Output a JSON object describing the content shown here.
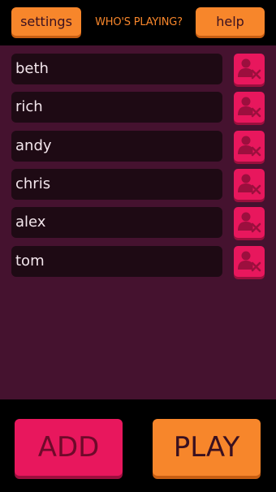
{
  "header": {
    "settings_label": "settings",
    "title": "WHO'S PLAYING?",
    "help_label": "help"
  },
  "players": [
    {
      "name": "beth",
      "remove_icon": "remove-user-icon"
    },
    {
      "name": "rich",
      "remove_icon": "remove-user-icon"
    },
    {
      "name": "andy",
      "remove_icon": "remove-user-icon"
    },
    {
      "name": "chris",
      "remove_icon": "remove-user-icon"
    },
    {
      "name": "alex",
      "remove_icon": "remove-user-icon"
    },
    {
      "name": "tom",
      "remove_icon": "remove-user-icon"
    }
  ],
  "footer": {
    "add_label": "ADD",
    "play_label": "PLAY"
  },
  "colors": {
    "orange": "#f7862b",
    "pink": "#e8175d",
    "panel": "#45122f",
    "field": "#1e0a14",
    "background": "#000000"
  }
}
